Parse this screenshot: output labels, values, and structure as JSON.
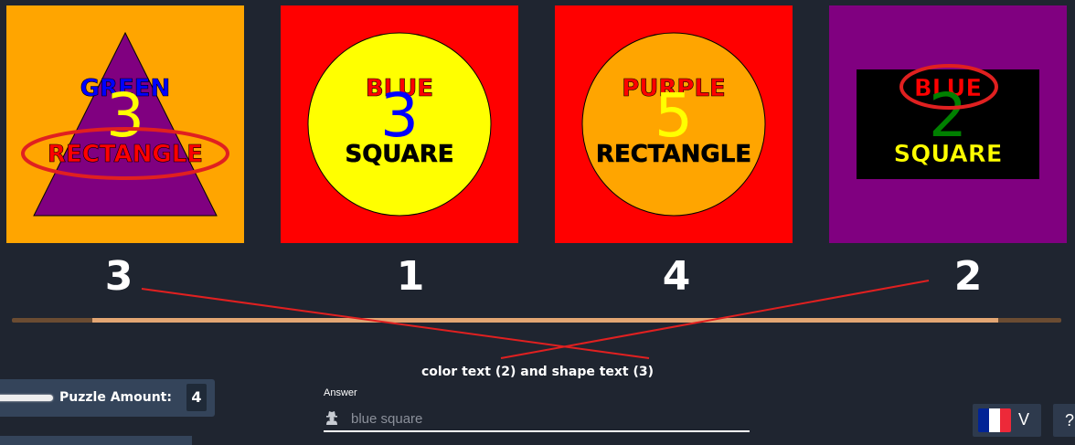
{
  "cards": [
    {
      "background": "#FFA500",
      "shape": "triangle",
      "shape_color": "#800080",
      "color_word": "GREEN",
      "color_word_fill": "#0000FF",
      "digit": "3",
      "digit_color": "#FFFF00",
      "shape_word": "RECTANGLE",
      "shape_word_fill": "#FF0000",
      "circled": "shape_word",
      "number_below": "3"
    },
    {
      "background": "#FF0000",
      "shape": "circle",
      "shape_color": "#FFFF00",
      "color_word": "BLUE",
      "color_word_fill": "#FF0000",
      "digit": "3",
      "digit_color": "#0000FF",
      "shape_word": "SQUARE",
      "shape_word_fill": "#000000",
      "circled": "",
      "number_below": "1"
    },
    {
      "background": "#FF0000",
      "shape": "circle",
      "shape_color": "#FFA500",
      "color_word": "PURPLE",
      "color_word_fill": "#FF0000",
      "digit": "5",
      "digit_color": "#FFFF00",
      "shape_word": "RECTANGLE",
      "shape_word_fill": "#000000",
      "circled": "",
      "number_below": "4"
    },
    {
      "background": "#800080",
      "shape": "rectangle",
      "shape_color": "#000000",
      "color_word": "BLUE",
      "color_word_fill": "#FF0000",
      "digit": "2",
      "digit_color": "#008000",
      "shape_word": "SQUARE",
      "shape_word_fill": "#FFFF00",
      "circled": "color_word",
      "number_below": "2"
    }
  ],
  "progress": 0.94,
  "instruction": "color text (2) and shape text (3)",
  "puzzle_amount": {
    "label": "Puzzle Amount:",
    "value": "4"
  },
  "answer": {
    "label": "Answer",
    "placeholder": "blue square",
    "value": ""
  },
  "language": {
    "code": "V",
    "flag_colors": [
      "#002395",
      "#FFFFFF",
      "#ED2939"
    ]
  },
  "help_label": "?",
  "annotation_color": "#E02020"
}
